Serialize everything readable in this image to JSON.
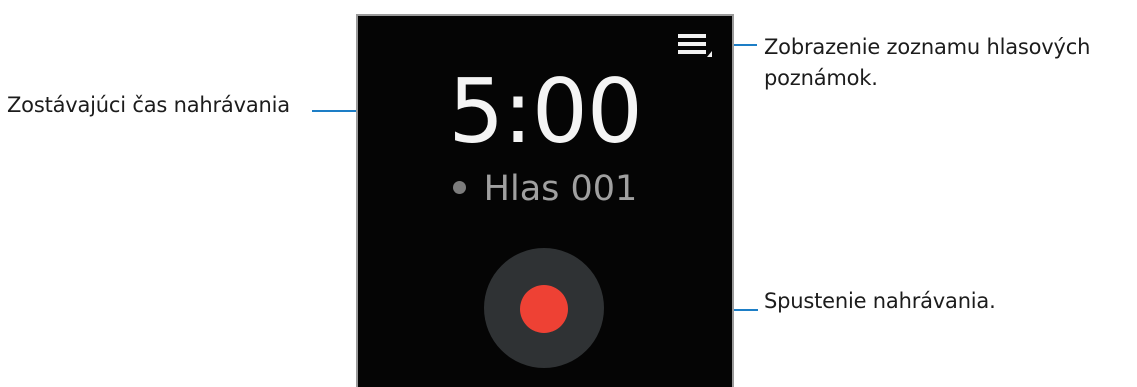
{
  "screen": {
    "timer": "5:00",
    "recording_name": "Hlas 001",
    "menu_icon": "list-menu-icon",
    "record_button_color": "#ee4134"
  },
  "callouts": {
    "remaining_time": "Zostávajúci čas nahrávania",
    "voice_list_line1": "Zobrazenie zoznamu hlasových",
    "voice_list_line2": "poznámok.",
    "start_recording": "Spustenie nahrávania."
  },
  "colors": {
    "callout_line": "#1d7ec6",
    "screen_background": "#050505",
    "record_outer": "#2f3234"
  }
}
